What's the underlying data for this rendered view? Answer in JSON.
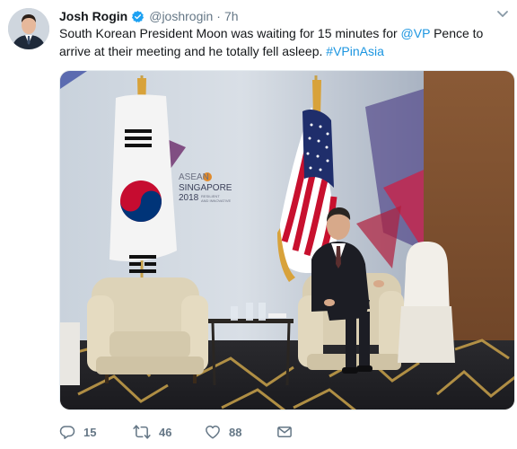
{
  "tweet": {
    "author_name": "Josh Rogin",
    "handle": "@joshrogin",
    "separator": "·",
    "time": "7h",
    "text_parts": [
      "South Korean President Moon was waiting for 15 minutes for ",
      "@VP",
      " Pence to arrive at their meeting and he totally fell asleep. ",
      "#VPinAsia"
    ],
    "banner": {
      "line1": "ASEAN",
      "line2": "SINGAPORE",
      "line3": "2018",
      "tagline1": "RESILIENT",
      "tagline2": "AND INNOVATIVE"
    },
    "actions": {
      "reply_count": "15",
      "retweet_count": "46",
      "like_count": "88"
    }
  },
  "icons": {
    "verified": "verified-badge-icon",
    "more": "chevron-down-icon",
    "reply": "reply-icon",
    "retweet": "retweet-icon",
    "like": "heart-icon",
    "dm": "envelope-icon"
  },
  "colors": {
    "link": "#1b95e0",
    "muted": "#657786",
    "text": "#14171a"
  }
}
